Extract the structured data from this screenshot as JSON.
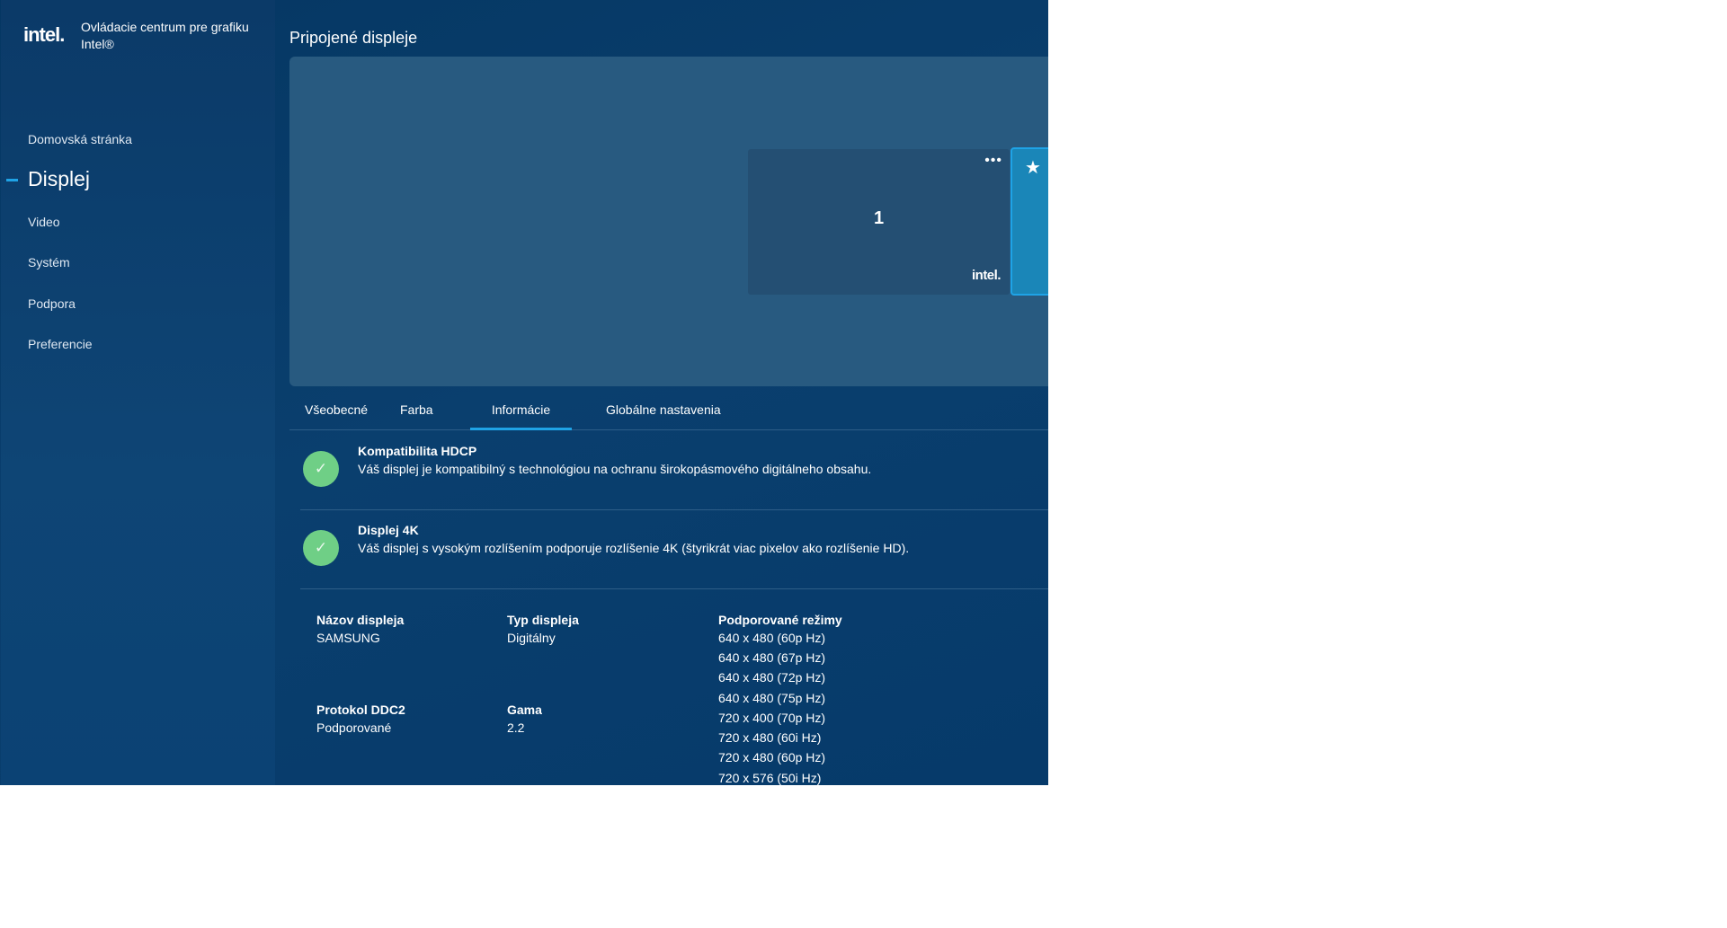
{
  "app": {
    "logo": "intel.",
    "title": "Ovládacie centrum pre grafiku Intel®"
  },
  "sidebar": {
    "items": [
      {
        "label": "Domovská stránka"
      },
      {
        "label": "Displej",
        "active": true
      },
      {
        "label": "Video"
      },
      {
        "label": "Systém"
      },
      {
        "label": "Podpora"
      },
      {
        "label": "Preferencie"
      }
    ]
  },
  "main": {
    "title": "Pripojené displeje",
    "display_card": {
      "number": "1",
      "more": "•••",
      "logo": "intel."
    },
    "tabs": [
      {
        "label": "Všeobecné"
      },
      {
        "label": "Farba"
      },
      {
        "label": "Informácie",
        "active": true
      },
      {
        "label": "Globálne nastavenia"
      }
    ],
    "features": [
      {
        "title": "Kompatibilita HDCP",
        "desc": "Váš displej je kompatibilný s technológiou na ochranu širokopásmového digitálneho obsahu."
      },
      {
        "title": "Displej 4K",
        "desc": "Váš displej s vysokým rozlíšením podporuje rozlíšenie 4K (štyrikrát viac pixelov ako rozlíšenie HD)."
      }
    ],
    "info": {
      "name_label": "Názov displeja",
      "name": "SAMSUNG",
      "type_label": "Typ displeja",
      "type": "Digitálny",
      "ddc_label": "Protokol DDC2",
      "ddc": "Podporované",
      "gamma_label": "Gama",
      "gamma": "2.2",
      "modes_label": "Podporované režimy",
      "modes": [
        "640 x 480 (60p Hz)",
        "640 x 480 (67p Hz)",
        "640 x 480 (72p Hz)",
        "640 x 480 (75p Hz)",
        "720 x 400 (70p Hz)",
        "720 x 480 (60i Hz)",
        "720 x 480 (60p Hz)",
        "720 x 576 (50i Hz)"
      ]
    }
  },
  "colors": {
    "accent": "#1fa3e6",
    "check": "#6fcf86"
  }
}
